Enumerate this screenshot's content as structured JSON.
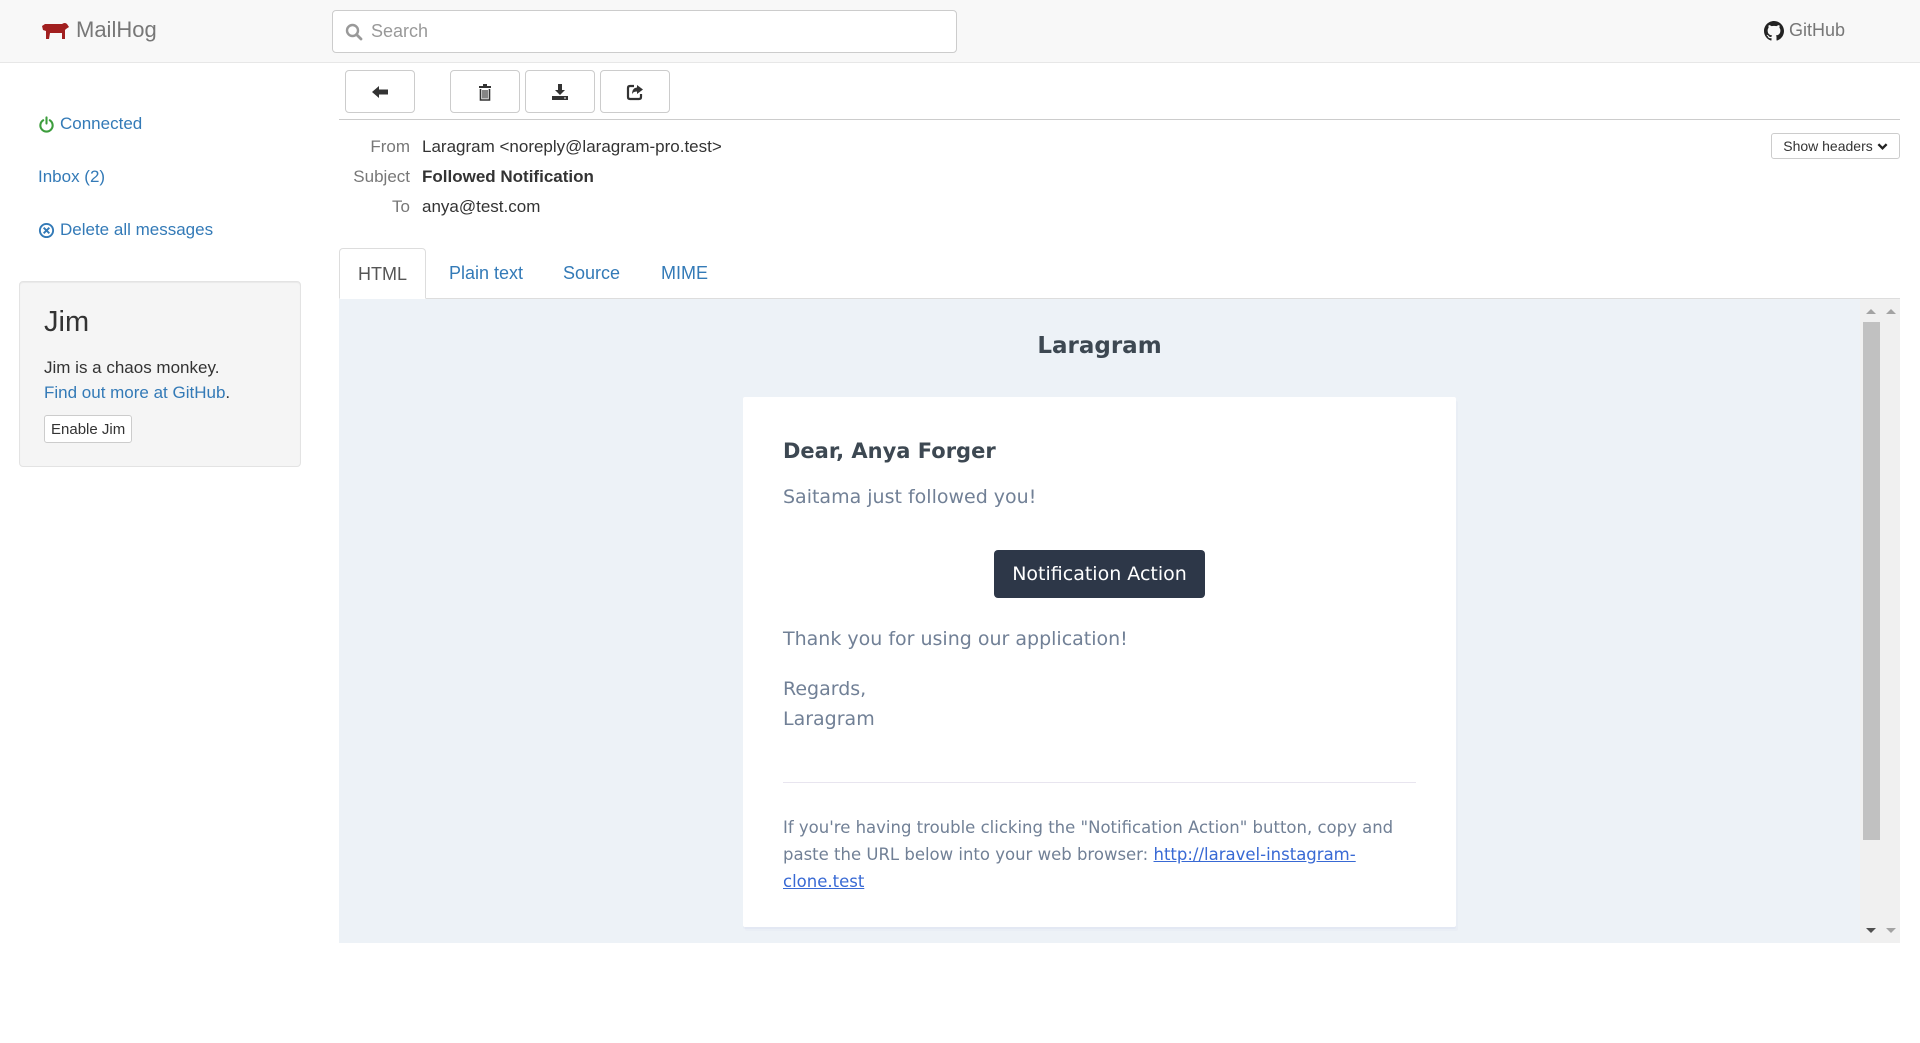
{
  "navbar": {
    "brand": "MailHog",
    "search_placeholder": "Search",
    "search_value": "",
    "github_label": "GitHub"
  },
  "sidebar": {
    "connection_status": "Connected",
    "inbox_label": "Inbox (2)",
    "delete_all_label": "Delete all messages",
    "jim": {
      "title": "Jim",
      "description": "Jim is a chaos monkey.",
      "link_text": "Find out more at GitHub",
      "link_suffix": ".",
      "enable_button": "Enable Jim"
    }
  },
  "toolbar": {
    "back_icon": "arrow-left-icon",
    "delete_icon": "trash-icon",
    "download_icon": "download-icon",
    "release_icon": "share-icon"
  },
  "message": {
    "headers": [
      {
        "label": "From",
        "value": "Laragram <noreply@laragram-pro.test>"
      },
      {
        "label": "Subject",
        "value": "Followed Notification"
      },
      {
        "label": "To",
        "value": "anya@test.com"
      }
    ],
    "show_headers_label": "Show headers"
  },
  "tabs": [
    {
      "label": "HTML",
      "active": true
    },
    {
      "label": "Plain text",
      "active": false
    },
    {
      "label": "Source",
      "active": false
    },
    {
      "label": "MIME",
      "active": false
    }
  ],
  "email": {
    "brand": "Laragram",
    "greeting": "Dear, Anya Forger",
    "intro": "Saitama just followed you!",
    "action_label": "Notification Action",
    "outro": "Thank you for using our application!",
    "salutation": "Regards,",
    "signature": "Laragram",
    "subcopy_text": "If you're having trouble clicking the \"Notification Action\" button, copy and paste the URL below into your web browser: ",
    "subcopy_url": "http://laravel-instagram-clone.test"
  },
  "colors": {
    "brand_red": "#9b1c1c",
    "link_blue": "#337ab7",
    "connected_green": "#3c763d",
    "action_button": "#2d3748",
    "email_bg": "#edf2f7"
  }
}
